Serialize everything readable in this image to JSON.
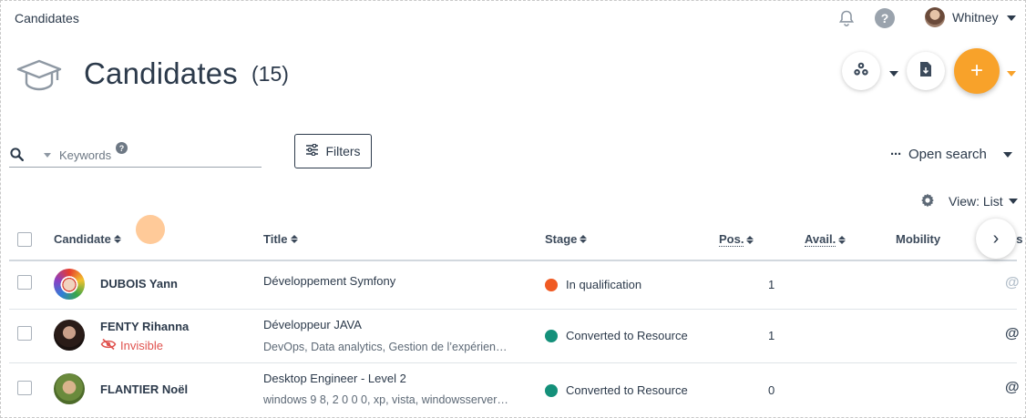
{
  "topbar": {
    "breadcrumb": "Candidates",
    "user_name": "Whitney"
  },
  "header": {
    "title": "Candidates",
    "count": "(15)"
  },
  "search": {
    "placeholder": "Keywords",
    "help": "?",
    "filters_label": "Filters",
    "open_search_label": "Open search",
    "more_glyph": "···"
  },
  "view": {
    "label": "View: List"
  },
  "table": {
    "columns": {
      "candidate": "Candidate",
      "title": "Title",
      "stage": "Stage",
      "pos": "Pos.",
      "avail": "Avail.",
      "mobility": "Mobility",
      "details_partial": "ils"
    },
    "rows": [
      {
        "name": "DUBOIS Yann",
        "title": "Développement Symfony",
        "subtitle": "",
        "badge": "",
        "stage": "In qualification",
        "stage_color": "#f05a23",
        "pos": "1",
        "at": "@",
        "at_color": "#b5c0cb"
      },
      {
        "name": "FENTY Rihanna",
        "title": "Développeur JAVA",
        "subtitle": "DevOps, Data analytics, Gestion de l’expérien…",
        "badge": "Invisible",
        "stage": "Converted to Resource",
        "stage_color": "#14907a",
        "pos": "1",
        "at": "@",
        "at_color": "#3c4a5b"
      },
      {
        "name": "FLANTIER Noël",
        "title": "Desktop Engineer - Level 2",
        "subtitle": "windows 9 8, 2 0 0 0, xp, vista, windowsserver…",
        "badge": "",
        "stage": "Converted to Resource",
        "stage_color": "#14907a",
        "pos": "0",
        "at": "@",
        "at_color": "#3c4a5b"
      }
    ]
  },
  "add_button": {
    "glyph": "+"
  },
  "scroll_right": {
    "glyph": "›"
  },
  "colors": {
    "accent": "#f8a22a",
    "text": "#2c3a4b",
    "invisible": "#e0534f"
  }
}
